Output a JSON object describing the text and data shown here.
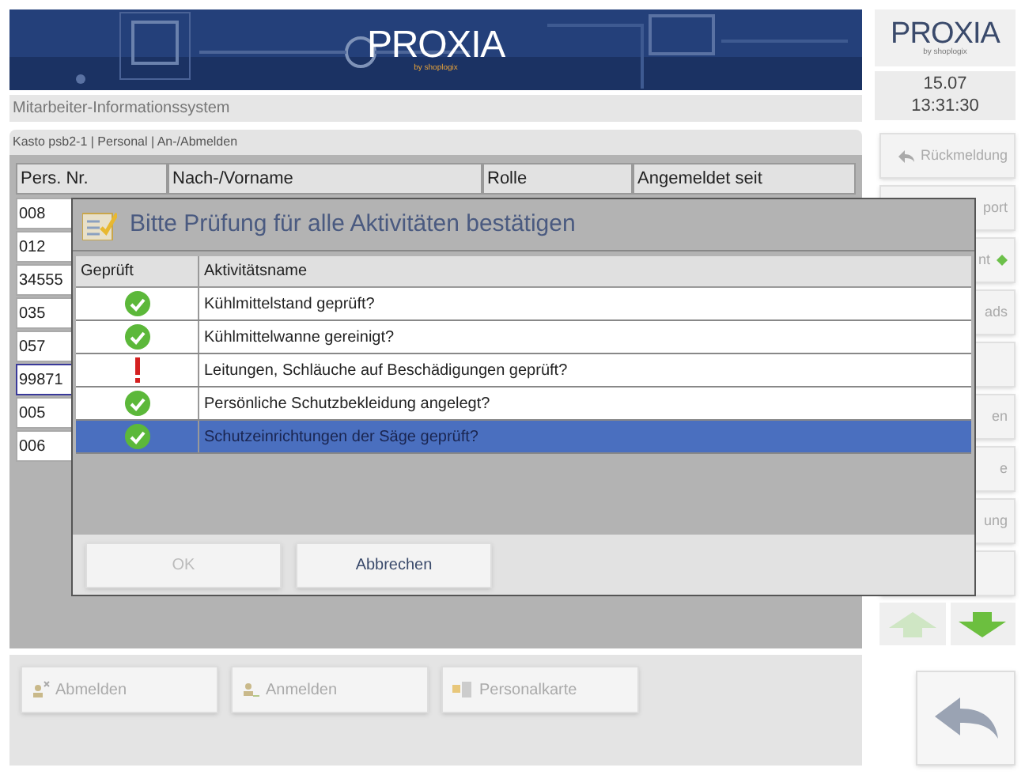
{
  "header": {
    "logo": "PROXIA",
    "logo_sub": "by shoplogix"
  },
  "app_title": "Mitarbeiter-Informationssystem",
  "breadcrumb": "Kasto psb2-1 | Personal | An-/Abmelden",
  "table": {
    "columns": [
      "Pers. Nr.",
      "Nach-/Vorname",
      "Rolle",
      "Angemeldet seit"
    ],
    "rows": [
      {
        "pers_nr": "008",
        "selected": false
      },
      {
        "pers_nr": "012",
        "selected": false
      },
      {
        "pers_nr": "34555",
        "selected": false
      },
      {
        "pers_nr": "035",
        "selected": false
      },
      {
        "pers_nr": "057",
        "selected": false
      },
      {
        "pers_nr": "99871",
        "selected": true
      },
      {
        "pers_nr": "005",
        "selected": false
      },
      {
        "pers_nr": "006",
        "selected": false
      }
    ]
  },
  "bottom_buttons": [
    {
      "label": "Abmelden",
      "kind": "logout",
      "disabled": true
    },
    {
      "label": "Anmelden",
      "kind": "login",
      "disabled": true
    },
    {
      "label": "Personalkarte",
      "kind": "card",
      "disabled": true
    }
  ],
  "sidebar": {
    "logo": "PROXIA",
    "logo_sub": "by shoplogix",
    "date": "15.07",
    "time": "13:31:30",
    "buttons": [
      {
        "label": "Rückmeldung",
        "kind": "reply",
        "disabled": true
      },
      {
        "label": "port",
        "kind": "text",
        "disabled": true
      },
      {
        "label": "nt",
        "kind": "marker",
        "disabled": true
      },
      {
        "label": "ads",
        "kind": "text",
        "disabled": true
      },
      {
        "kind": "blank"
      },
      {
        "label": "en",
        "kind": "text",
        "disabled": true
      },
      {
        "label": "e",
        "kind": "text",
        "disabled": true
      },
      {
        "label": "ung",
        "kind": "text",
        "disabled": true
      },
      {
        "kind": "blank"
      }
    ],
    "arrows": [
      {
        "kind": "up",
        "disabled": true
      },
      {
        "kind": "down",
        "disabled": false
      }
    ]
  },
  "dialog": {
    "title": "Bitte Prüfung für alle Aktivitäten bestätigen",
    "columns": [
      "Geprüft",
      "Aktivitätsname"
    ],
    "rows": [
      {
        "kind": "ok",
        "name": "Kühlmittelstand geprüft?",
        "selected": false
      },
      {
        "kind": "ok",
        "name": "Kühlmittelwanne gereinigt?",
        "selected": false
      },
      {
        "kind": "warning",
        "name": "Leitungen, Schläuche auf Beschädigungen geprüft?",
        "selected": false
      },
      {
        "kind": "ok",
        "name": "Persönliche Schutzbekleidung angelegt?",
        "selected": false
      },
      {
        "kind": "ok",
        "name": "Schutzeinrichtungen der Säge geprüft?",
        "selected": true
      }
    ],
    "buttons": [
      {
        "label": "OK",
        "disabled": true
      },
      {
        "label": "Abbrechen",
        "disabled": false
      }
    ]
  }
}
